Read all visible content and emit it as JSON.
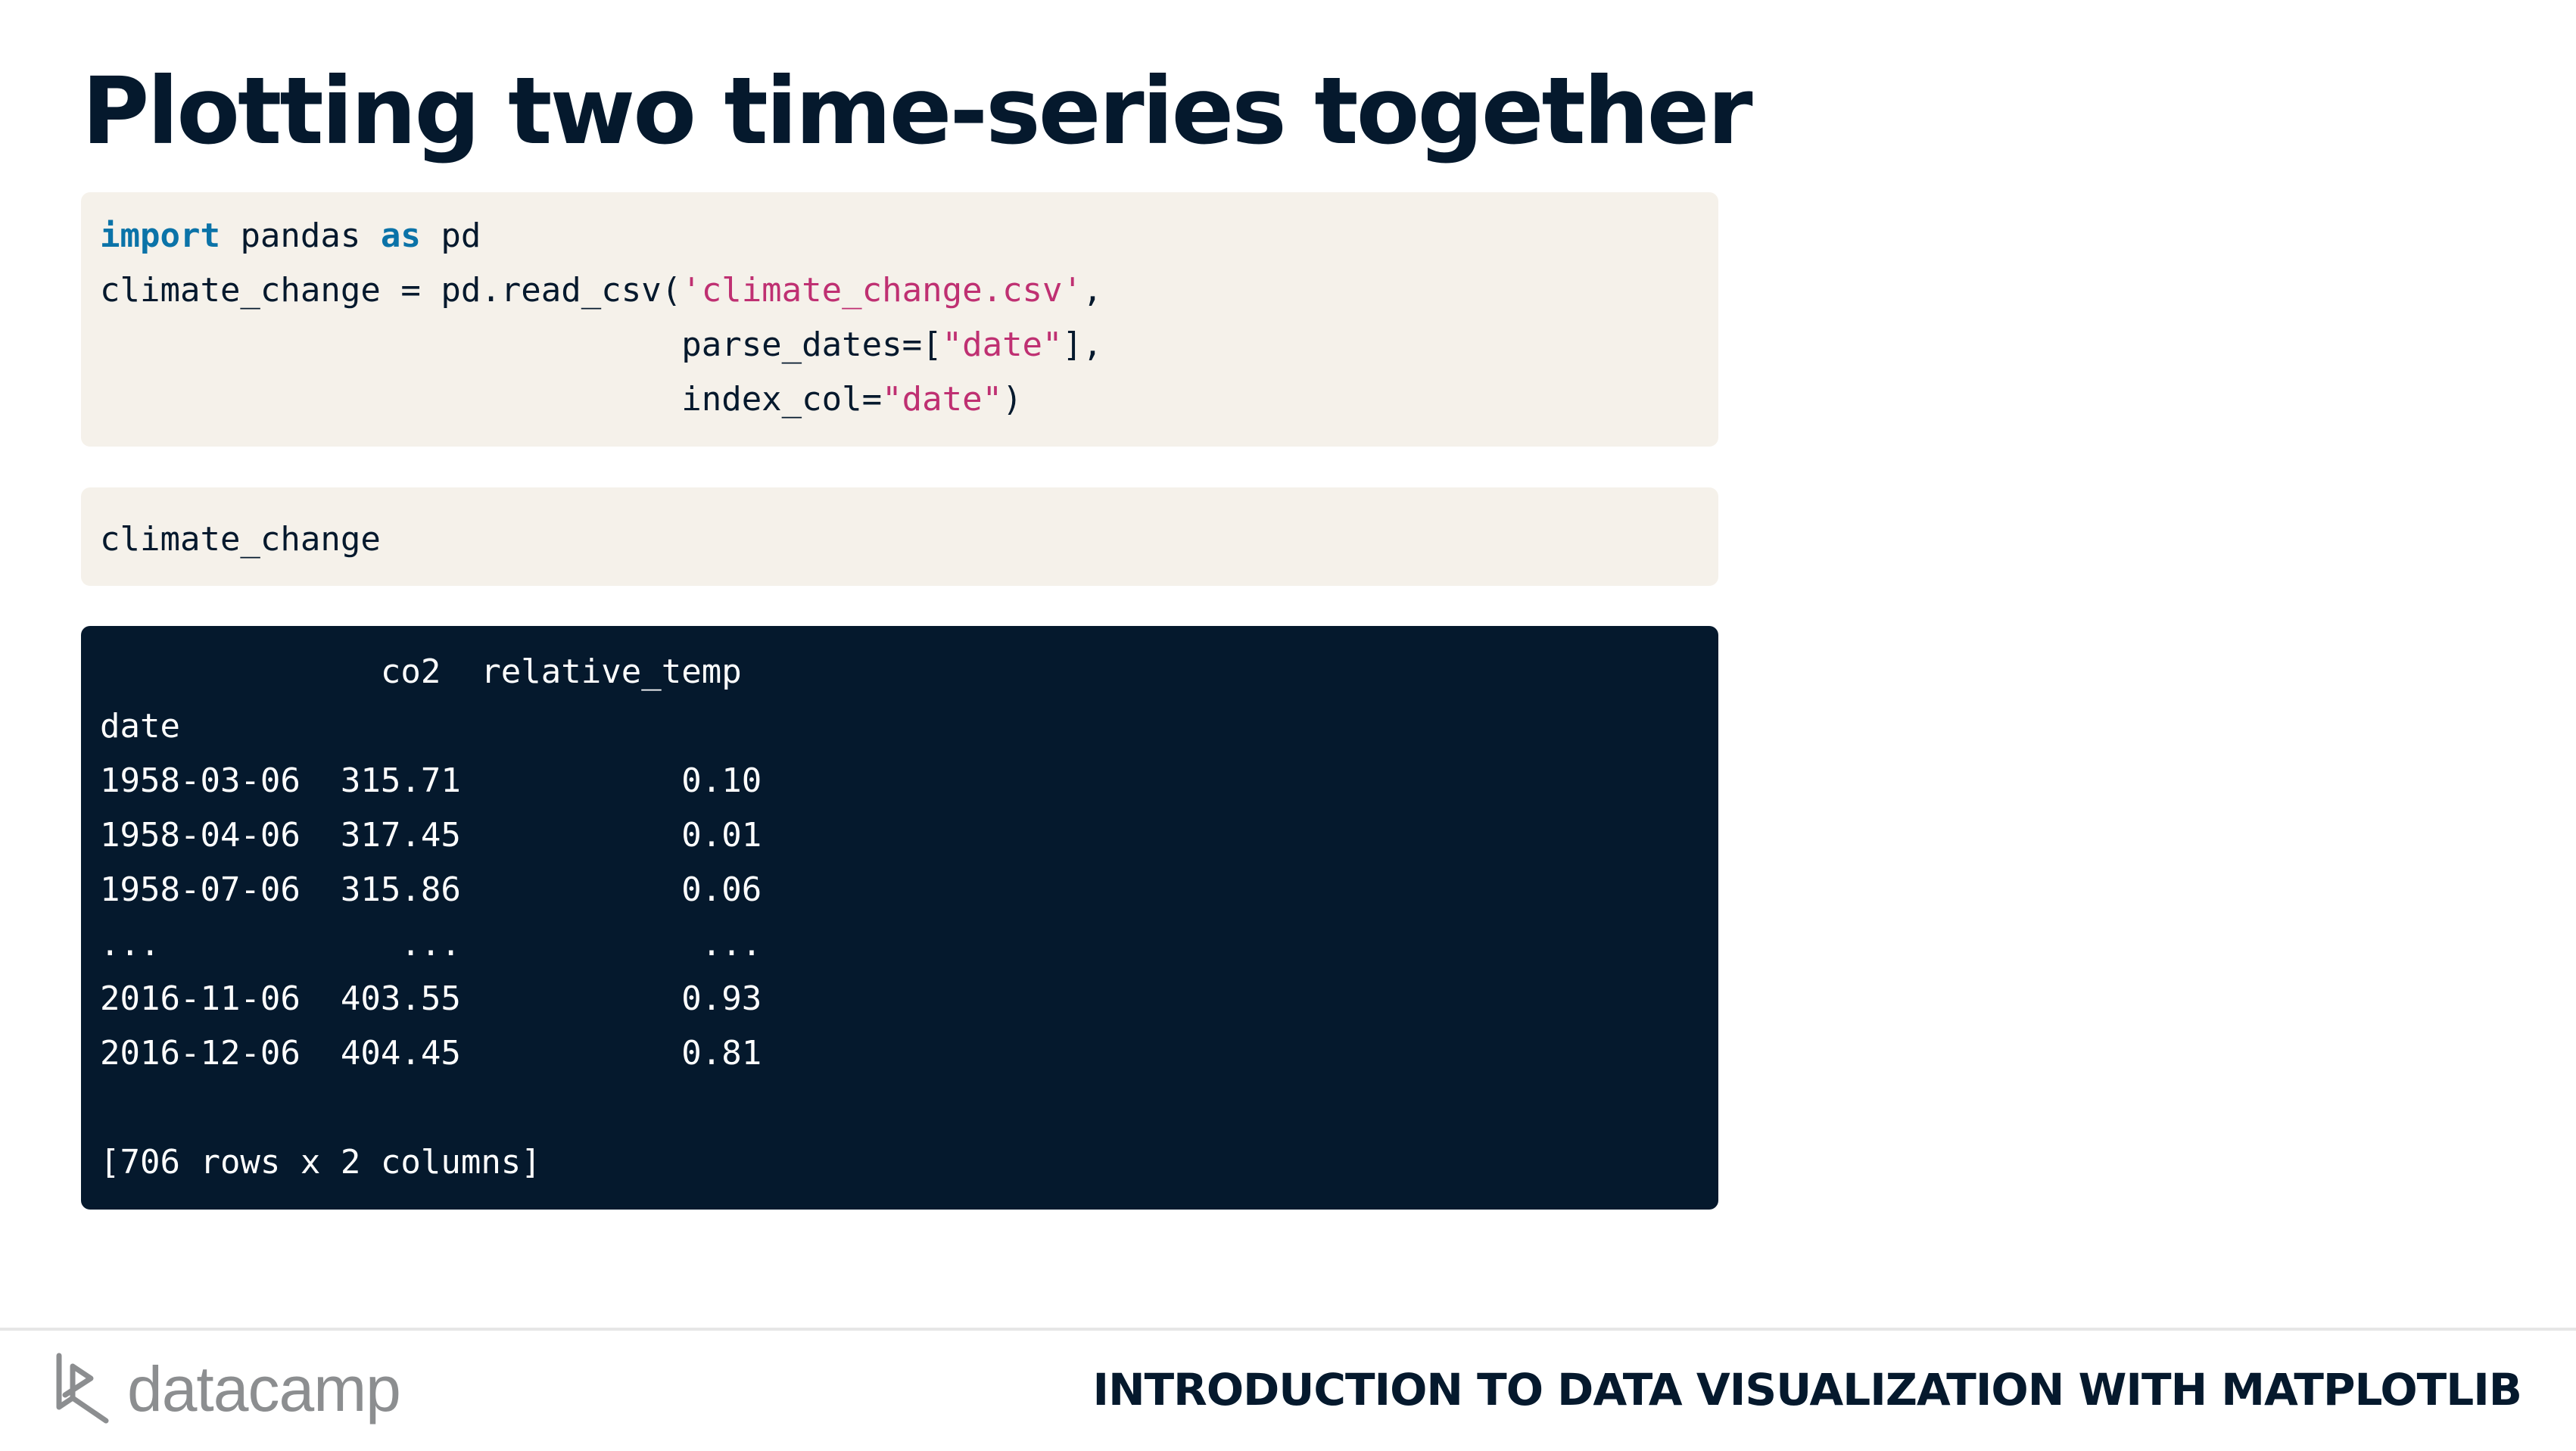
{
  "slide": {
    "title": "Plotting two time-series together"
  },
  "code_block_1": {
    "kw_import": "import",
    "module": " pandas ",
    "kw_as": "as",
    "alias": " pd",
    "line2_pre": "climate_change = pd.read_csv(",
    "line2_str": "'climate_change.csv'",
    "line2_post": ",",
    "line3_pre": "                             parse_dates=[",
    "line3_str": "\"date\"",
    "line3_post": "],",
    "line4_pre": "                             index_col=",
    "line4_str": "\"date\"",
    "line4_post": ")"
  },
  "code_block_2": {
    "line1": "climate_change"
  },
  "output": {
    "header": "              co2  relative_temp",
    "index_name": "date",
    "rows": [
      "1958-03-06  315.71           0.10",
      "1958-04-06  317.45           0.01",
      "1958-07-06  315.86           0.06",
      "...            ...            ...",
      "2016-11-06  403.55           0.93",
      "2016-12-06  404.45           0.81"
    ],
    "summary": "[706 rows x 2 columns]"
  },
  "footer": {
    "brand": "datacamp",
    "course": "INTRODUCTION TO DATA VISUALIZATION WITH MATPLOTLIB"
  },
  "colors": {
    "navy": "#05192d",
    "code_bg": "#f5f1ea",
    "keyword": "#0b73a8",
    "string": "#bf3072",
    "brand_gray": "#8c8e90"
  },
  "icons": {
    "brand_mark": "datacamp-logo-icon"
  }
}
